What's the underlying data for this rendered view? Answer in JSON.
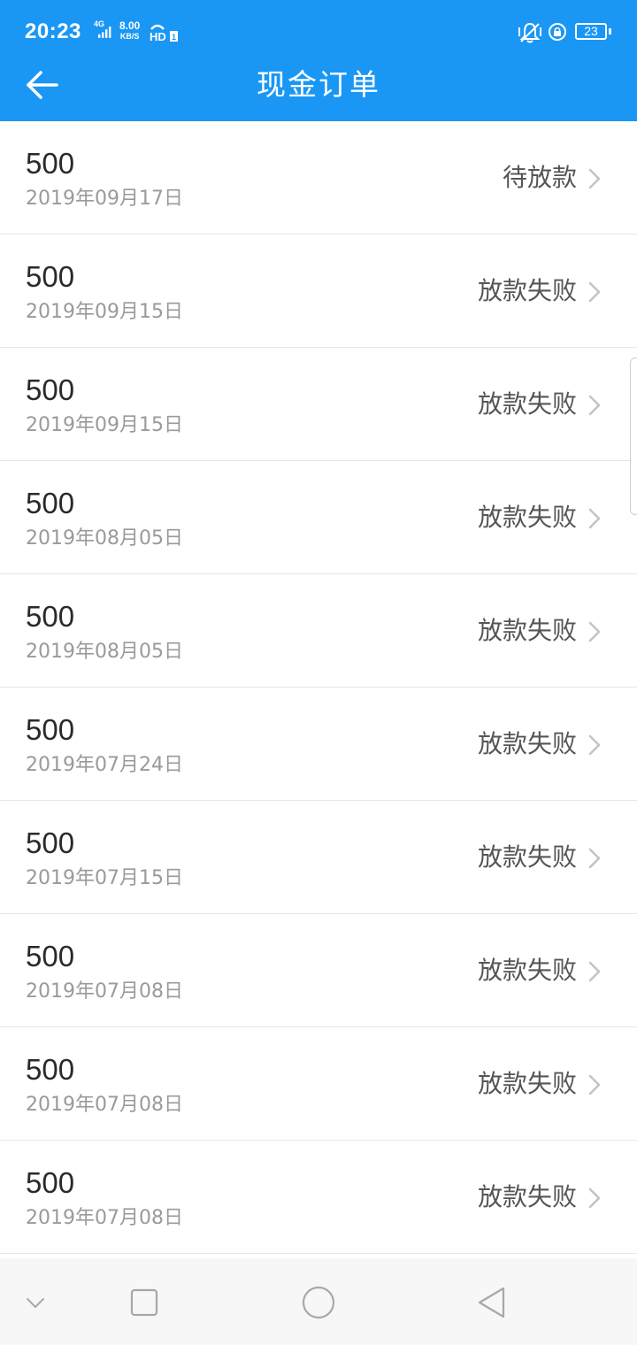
{
  "status_bar": {
    "time": "20:23",
    "network": "4G",
    "speed_value": "8.00",
    "speed_unit": "KB/S",
    "battery": "23"
  },
  "header": {
    "title": "现金订单",
    "background_color": "#1a97f5"
  },
  "orders": [
    {
      "amount": "500",
      "date": "2019年09月17日",
      "status": "待放款"
    },
    {
      "amount": "500",
      "date": "2019年09月15日",
      "status": "放款失败"
    },
    {
      "amount": "500",
      "date": "2019年09月15日",
      "status": "放款失败"
    },
    {
      "amount": "500",
      "date": "2019年08月05日",
      "status": "放款失败"
    },
    {
      "amount": "500",
      "date": "2019年08月05日",
      "status": "放款失败"
    },
    {
      "amount": "500",
      "date": "2019年07月24日",
      "status": "放款失败"
    },
    {
      "amount": "500",
      "date": "2019年07月15日",
      "status": "放款失败"
    },
    {
      "amount": "500",
      "date": "2019年07月08日",
      "status": "放款失败"
    },
    {
      "amount": "500",
      "date": "2019年07月08日",
      "status": "放款失败"
    },
    {
      "amount": "500",
      "date": "2019年07月08日",
      "status": "放款失败"
    }
  ],
  "nav_bar": {
    "icons": [
      "chevron-down-icon",
      "recent-apps-icon",
      "home-icon",
      "back-triangle-icon"
    ]
  }
}
